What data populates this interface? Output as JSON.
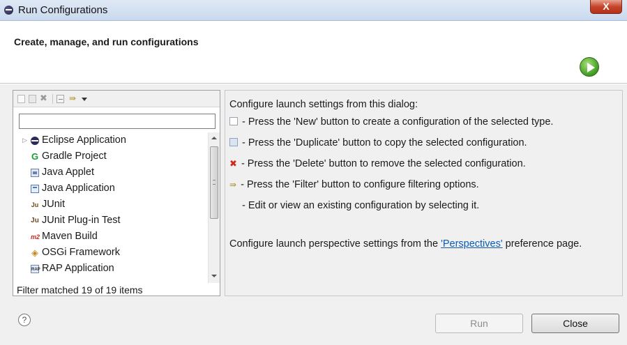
{
  "window": {
    "title": "Run Configurations",
    "close_label": "X"
  },
  "header": {
    "title": "Create, manage, and run configurations"
  },
  "filter": {
    "value": "",
    "status": "Filter matched 19 of 19 items"
  },
  "tree": {
    "items": [
      {
        "label": "Eclipse Application",
        "icon": "eclipse-icon",
        "expander": "▷"
      },
      {
        "label": "Gradle Project",
        "icon": "gradle-icon",
        "glyph": "G"
      },
      {
        "label": "Java Applet",
        "icon": "java-applet-icon"
      },
      {
        "label": "Java Application",
        "icon": "java-application-icon"
      },
      {
        "label": "JUnit",
        "icon": "junit-icon",
        "glyph": "Ju"
      },
      {
        "label": "JUnit Plug-in Test",
        "icon": "junit-plugin-icon",
        "glyph": "Ju"
      },
      {
        "label": "Maven Build",
        "icon": "maven-icon",
        "glyph": "m2"
      },
      {
        "label": "OSGi Framework",
        "icon": "osgi-icon",
        "glyph": "◈"
      },
      {
        "label": "RAP Application",
        "icon": "rap-icon",
        "glyph": "RAP"
      }
    ]
  },
  "info": {
    "intro": "Configure launch settings from this dialog:",
    "new_line": "- Press the 'New' button to create a configuration of the selected type.",
    "duplicate_line": "- Press the 'Duplicate' button to copy the selected configuration.",
    "delete_line": "- Press the 'Delete' button to remove the selected configuration.",
    "filter_line": "- Press the 'Filter' button to configure filtering options.",
    "edit_line": "- Edit or view an existing configuration by selecting it.",
    "perspective_prefix": "Configure launch perspective settings from the ",
    "perspective_link": "'Perspectives'",
    "perspective_suffix": " preference page."
  },
  "buttons": {
    "help": "?",
    "run": "Run",
    "close": "Close"
  },
  "colors": {
    "link": "#0b5bb5",
    "delete_icon": "#d0261c",
    "run_icon": "#3f9a22"
  }
}
